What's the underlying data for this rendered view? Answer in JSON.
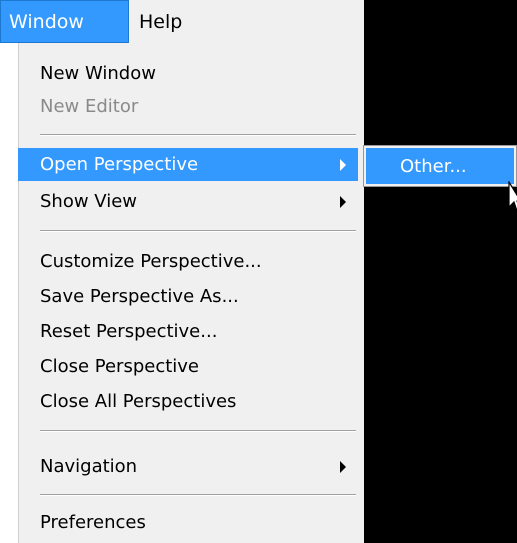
{
  "menubar": {
    "items": [
      {
        "label": "Window",
        "active": true
      },
      {
        "label": "Help",
        "active": false
      }
    ]
  },
  "window_menu": {
    "items": [
      {
        "label": "New Window",
        "disabled": false,
        "submenu": false
      },
      {
        "label": "New Editor",
        "disabled": true,
        "submenu": false
      },
      {
        "label": "Open Perspective",
        "disabled": false,
        "submenu": true,
        "highlighted": true
      },
      {
        "label": "Show View",
        "disabled": false,
        "submenu": true
      },
      {
        "label": "Customize Perspective...",
        "disabled": false,
        "submenu": false
      },
      {
        "label": "Save Perspective As...",
        "disabled": false,
        "submenu": false
      },
      {
        "label": "Reset Perspective...",
        "disabled": false,
        "submenu": false
      },
      {
        "label": "Close Perspective",
        "disabled": false,
        "submenu": false
      },
      {
        "label": "Close All Perspectives",
        "disabled": false,
        "submenu": false
      },
      {
        "label": "Navigation",
        "disabled": false,
        "submenu": true
      },
      {
        "label": "Preferences",
        "disabled": false,
        "submenu": false
      }
    ]
  },
  "perspective_submenu": {
    "items": [
      {
        "label": "Other...",
        "highlighted": true
      }
    ]
  },
  "icons": {
    "submenu_arrow": "chevron-right-icon",
    "cursor": "mouse-pointer-icon"
  },
  "colors": {
    "highlight": "#3399ff",
    "menu_background": "#f0f0f0",
    "disabled_text": "#8a8a8a",
    "editor_background": "#000000"
  }
}
